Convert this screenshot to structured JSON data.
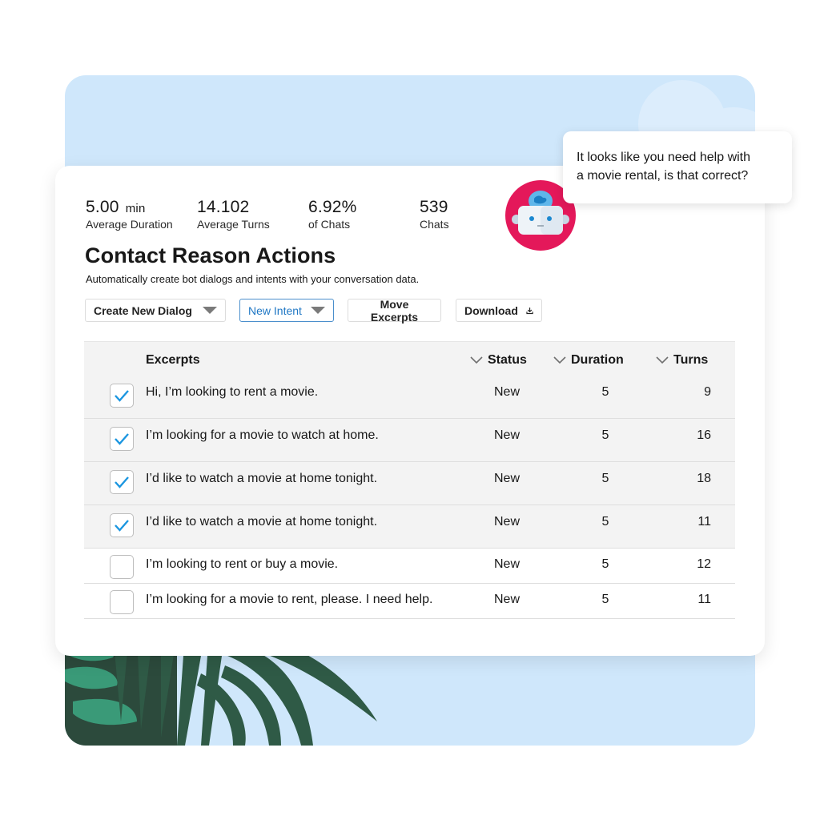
{
  "colors": {
    "backdrop": "#cfe7fb",
    "accent_blue": "#1f77c4",
    "avatar_ring": "#e4185a",
    "leaf_dark": "#2f5a46",
    "leaf_light": "#3a9a78"
  },
  "stats": [
    {
      "value": "5.00",
      "unit": "min",
      "label": "Average Duration"
    },
    {
      "value": "14.102",
      "unit": "",
      "label": "Average Turns"
    },
    {
      "value": "6.92%",
      "unit": "",
      "label": "of Chats"
    },
    {
      "value": "539",
      "unit": "",
      "label": "Chats"
    }
  ],
  "header": {
    "title": "Contact Reason Actions",
    "subtitle": "Automatically create bot dialogs and intents with your conversation data."
  },
  "toolbar": {
    "create_dialog_label": "Create New Dialog",
    "new_intent_label": "New Intent",
    "move_excerpts_label": "Move Excerpts",
    "download_label": "Download"
  },
  "table": {
    "columns": {
      "excerpts": "Excerpts",
      "status": "Status",
      "duration": "Duration",
      "turns": "Turns"
    },
    "rows": [
      {
        "checked": true,
        "excerpt": "Hi, I’m looking to rent a movie.",
        "status": "New",
        "duration": "5",
        "turns": "9"
      },
      {
        "checked": true,
        "excerpt": "I’m looking for a movie to watch at home.",
        "status": "New",
        "duration": "5",
        "turns": "16"
      },
      {
        "checked": true,
        "excerpt": "I’d like to watch a movie at home tonight.",
        "status": "New",
        "duration": "5",
        "turns": "18"
      },
      {
        "checked": true,
        "excerpt": "I’d like to watch a movie at home tonight.",
        "status": "New",
        "duration": "5",
        "turns": "11"
      },
      {
        "checked": false,
        "excerpt": "I’m looking to rent or buy a movie.",
        "status": "New",
        "duration": "5",
        "turns": "12"
      },
      {
        "checked": false,
        "excerpt": "I’m looking for a movie to rent, please. I need help.",
        "status": "New",
        "duration": "5",
        "turns": "11"
      }
    ]
  },
  "bot": {
    "avatar_icon": "robot-icon",
    "message_line1": "It looks like you need help with",
    "message_line2": "a movie rental, is that correct?"
  }
}
